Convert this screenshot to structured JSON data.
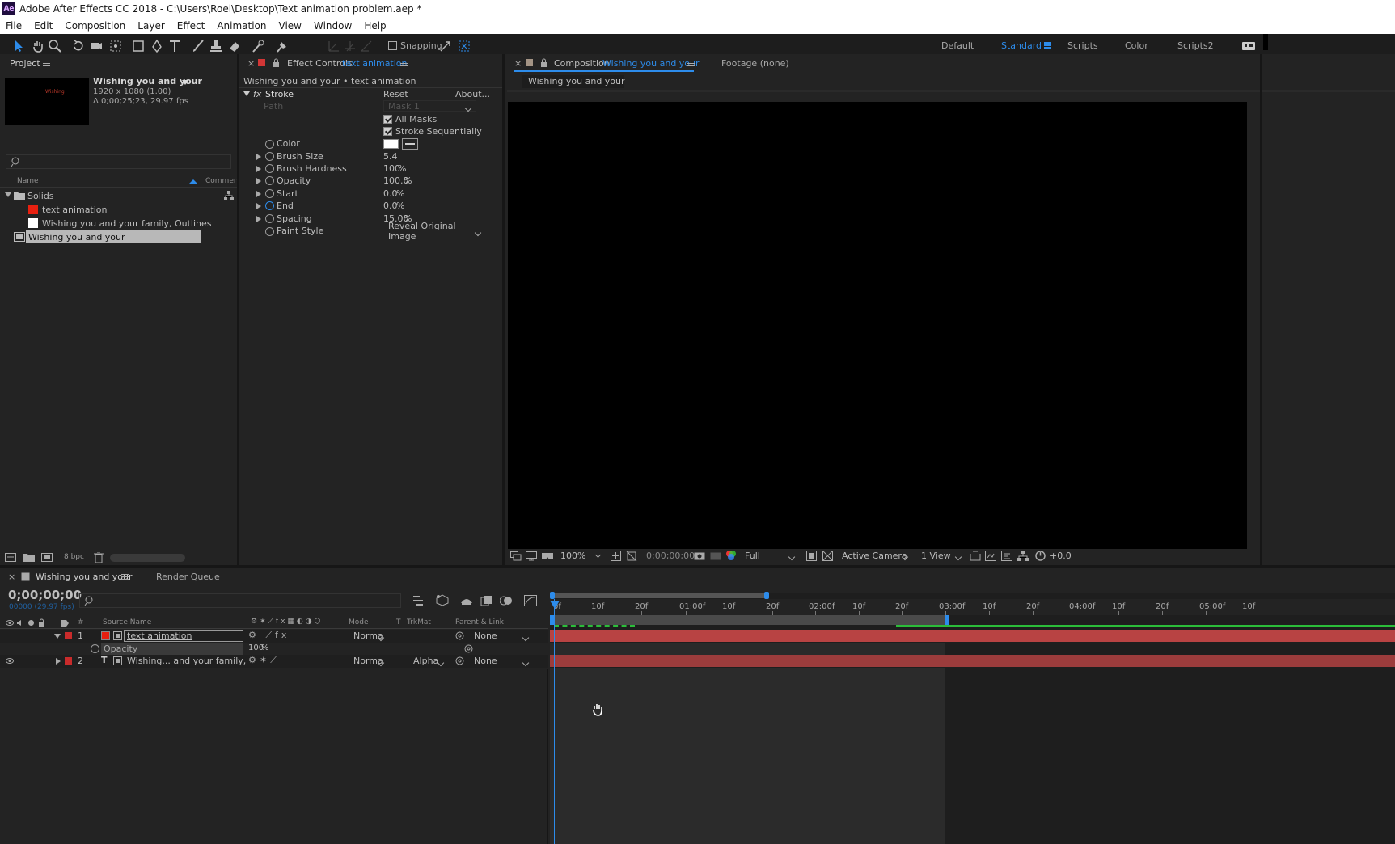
{
  "window": {
    "title": "Adobe After Effects CC 2018 - C:\\Users\\Roei\\Desktop\\Text animation problem.aep *",
    "app_icon": "Ae"
  },
  "menu": [
    "File",
    "Edit",
    "Composition",
    "Layer",
    "Effect",
    "Animation",
    "View",
    "Window",
    "Help"
  ],
  "toolbar": {
    "snapping_label": "Snapping",
    "workspaces": [
      "Default",
      "Standard",
      "Scripts",
      "Color",
      "Scripts2"
    ],
    "active_workspace": "Standard"
  },
  "project": {
    "tab_label": "Project",
    "comp_name": "Wishing you and your",
    "comp_res": "1920 x 1080 (1.00)",
    "comp_dur": "Δ 0;00;25;23, 29.97 fps",
    "thumb_text": "Wishing",
    "col_name": "Name",
    "col_comment": "Comment",
    "items": [
      {
        "name": "Solids",
        "type": "folder"
      },
      {
        "name": "text animation",
        "type": "solid",
        "color": "#e82010"
      },
      {
        "name": "Wishing you and   your family, Outlines",
        "type": "solid",
        "color": "#ffffff"
      },
      {
        "name": "Wishing you and your",
        "type": "comp",
        "selected": true
      }
    ],
    "bpc": "8 bpc"
  },
  "effect_controls": {
    "tab_prefix": "Effect Controls",
    "tab_layer": "text animation",
    "breadcrumb": "Wishing you and your • text animation",
    "effect_name": "Stroke",
    "reset": "Reset",
    "about": "About...",
    "path_label": "Path",
    "path_value": "Mask 1",
    "all_masks": "All Masks",
    "stroke_seq": "Stroke Sequentially",
    "props": [
      {
        "label": "Color",
        "value": "",
        "unit": ""
      },
      {
        "label": "Brush Size",
        "value": "5.4",
        "unit": ""
      },
      {
        "label": "Brush Hardness",
        "value": "100",
        "unit": "%"
      },
      {
        "label": "Opacity",
        "value": "100.0",
        "unit": "%"
      },
      {
        "label": "Start",
        "value": "0.0",
        "unit": "%"
      },
      {
        "label": "End",
        "value": "0.0",
        "unit": "%"
      },
      {
        "label": "Spacing",
        "value": "15.00",
        "unit": "%"
      },
      {
        "label": "Paint Style",
        "value": "Reveal Original Image",
        "unit": ""
      }
    ]
  },
  "composition": {
    "tab_prefix": "Composition",
    "tab_name": "Wishing you and your",
    "footage_tab": "Footage (none)",
    "sub_tab": "Wishing you and your",
    "zoom": "100%",
    "timecode": "0;00;00;00",
    "resolution": "Full",
    "camera": "Active Camera",
    "views": "1 View",
    "exposure": "+0.0"
  },
  "timeline": {
    "tab_name": "Wishing you and your",
    "render_queue": "Render Queue",
    "timecode": "0;00;00;00",
    "frames": "00000 (29.97 fps)",
    "col_headers": {
      "source": "Source Name",
      "mode": "Mode",
      "t": "T",
      "trkmat": "TrkMat",
      "parent": "Parent & Link"
    },
    "ruler": [
      "0f",
      "10f",
      "20f",
      "01:00f",
      "10f",
      "20f",
      "02:00f",
      "10f",
      "20f",
      "03:00f",
      "10f",
      "20f",
      "04:00f",
      "10f",
      "20f",
      "05:00f",
      "10f"
    ],
    "layers": [
      {
        "num": "1",
        "name": "text animation",
        "mode": "Norma",
        "trkmat": "",
        "parent": "None",
        "color": "#c92b2b"
      },
      {
        "num": "2",
        "name": "Wishing... and   your family,",
        "mode": "Norma",
        "trkmat": "Alpha",
        "parent": "None",
        "color": "#c92b2b"
      }
    ],
    "opacity_label": "Opacity",
    "opacity_value": "100",
    "opacity_unit": "%"
  }
}
